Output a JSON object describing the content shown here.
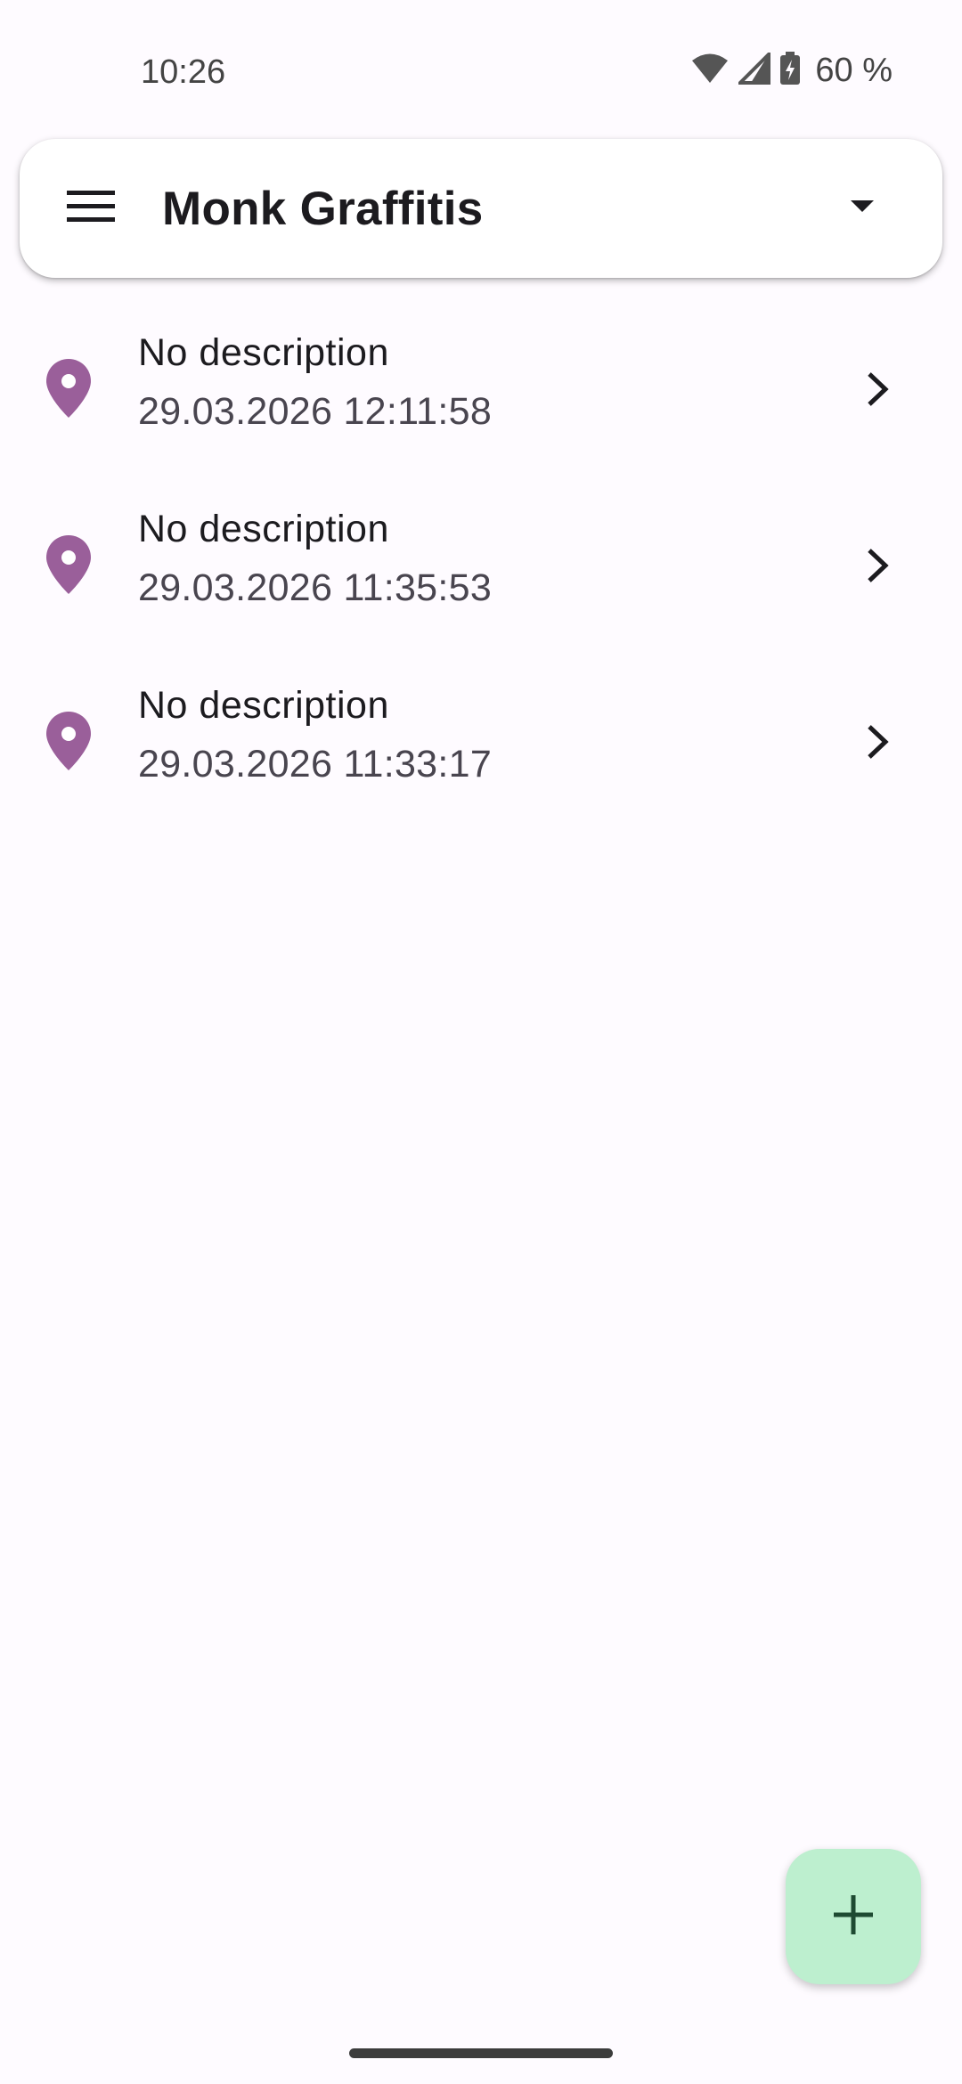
{
  "status_bar": {
    "time": "10:26",
    "battery_text": "60 %"
  },
  "app_bar": {
    "title": "Monk Graffitis",
    "menu_icon": "hamburger-menu-icon",
    "dropdown_icon": "arrow-drop-down-icon"
  },
  "list": {
    "items": [
      {
        "title": "No description",
        "subtitle": "29.03.2026 12:11:58"
      },
      {
        "title": "No description",
        "subtitle": "29.03.2026 11:35:53"
      },
      {
        "title": "No description",
        "subtitle": "29.03.2026 11:33:17"
      }
    ],
    "leading_icon": "location-pin-icon",
    "trailing_icon": "chevron-right-icon"
  },
  "fab": {
    "icon": "add-icon"
  },
  "colors": {
    "pin": "#9a5f9a",
    "fab_bg": "#bdefcf",
    "fab_icon": "#1e4a32"
  }
}
